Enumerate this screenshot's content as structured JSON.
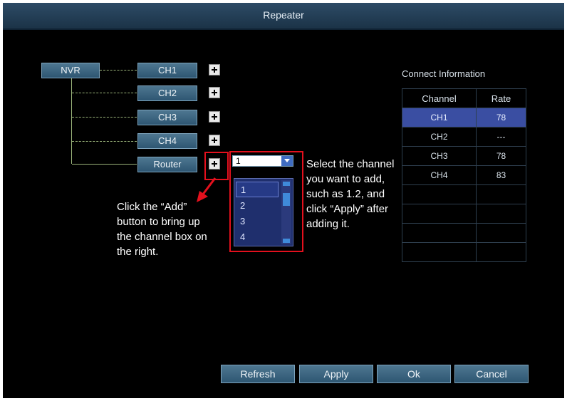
{
  "window": {
    "title": "Repeater"
  },
  "tree": {
    "root": "NVR",
    "channels": [
      "CH1",
      "CH2",
      "CH3",
      "CH4"
    ],
    "router": "Router"
  },
  "channel_select": {
    "value": "1",
    "options": [
      "1",
      "2",
      "3",
      "4"
    ]
  },
  "annotations": {
    "add_note": [
      "Click the “Add”",
      "button to bring up",
      "the channel box on",
      "the right."
    ],
    "select_note": [
      "Select the channel",
      "you want to add,",
      "such as 1.2, and",
      "click “Apply” after",
      "adding it."
    ]
  },
  "connect_info": {
    "title": "Connect Information",
    "headers": [
      "Channel",
      "Rate"
    ],
    "rows": [
      {
        "channel": "CH1",
        "rate": "78"
      },
      {
        "channel": "CH2",
        "rate": "---"
      },
      {
        "channel": "CH3",
        "rate": "78"
      },
      {
        "channel": "CH4",
        "rate": "83"
      },
      {
        "channel": "",
        "rate": ""
      },
      {
        "channel": "",
        "rate": ""
      },
      {
        "channel": "",
        "rate": ""
      },
      {
        "channel": "",
        "rate": ""
      }
    ]
  },
  "buttons": {
    "refresh": "Refresh",
    "apply": "Apply",
    "ok": "Ok",
    "cancel": "Cancel"
  }
}
